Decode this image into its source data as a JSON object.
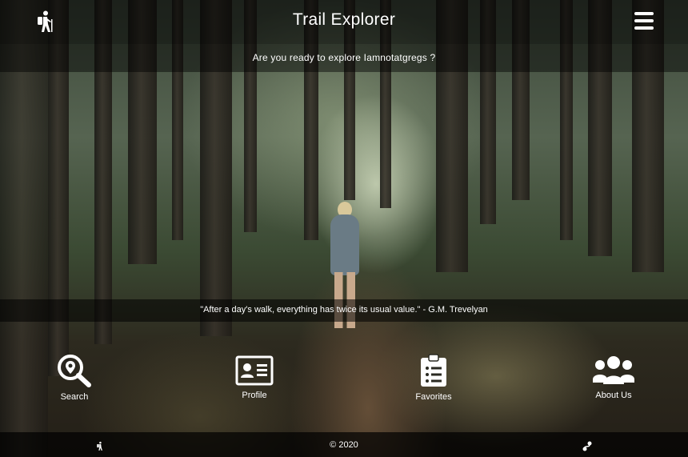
{
  "header": {
    "title": "Trail Explorer",
    "logo_icon": "hiker-icon",
    "menu_icon": "hamburger-menu-icon"
  },
  "welcome": {
    "text": "Are you ready to explore Iamnotatgregs ?"
  },
  "quote": {
    "text": "\"After a day's walk, everything has twice its usual value.\" - G.M. Trevelyan"
  },
  "nav": {
    "search": {
      "label": "Search",
      "icon": "search-location-icon"
    },
    "profile": {
      "label": "Profile",
      "icon": "id-card-icon"
    },
    "favorites": {
      "label": "Favorites",
      "icon": "clipboard-list-icon"
    },
    "about": {
      "label": "About Us",
      "icon": "users-icon"
    }
  },
  "footer": {
    "copyright": "© 2020",
    "left_icon": "hiker-icon",
    "right_icon": "route-icon"
  },
  "colors": {
    "text": "#ffffff",
    "bar_overlay": "#000000"
  }
}
